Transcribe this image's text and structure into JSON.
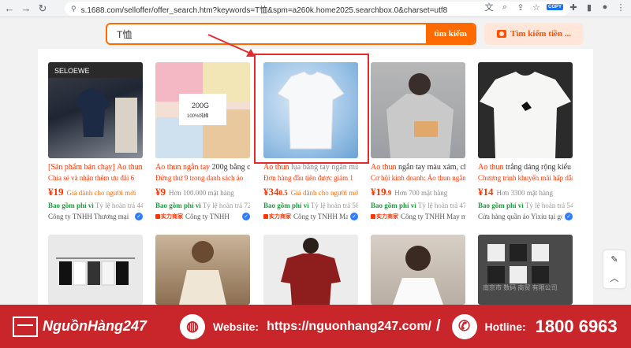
{
  "browser": {
    "url": "s.1688.com/selloffer/offer_search.htm?keywords=T恤&spm=a260k.home2025.searchbox.0&charset=utf8",
    "copy_badge": "COPY"
  },
  "search": {
    "value": "T恤",
    "button": "tìm kiếm",
    "image_search": "Tìm kiếm tiền ..."
  },
  "products": [
    {
      "title_hl": "[Sản phẩm bán chạy] Áo thun",
      "title_rest": "",
      "promo": "Chia sẻ và nhận thêm ưu đãi 6",
      "price_main": "¥19",
      "price_dec": "",
      "price_note": "Giá dành cho người mới",
      "ship_g": "Bao gồm phí vì",
      "ship_rest": "Tỷ lệ hoàn trả 44%",
      "badge": "",
      "shop": "Công ty TNHH Thương mại"
    },
    {
      "title_hl": "Áo thun ngắn tay",
      "title_rest": " 200g bằng c",
      "promo": "Đứng thứ 9 trong danh sách áo",
      "price_main": "¥9",
      "price_dec": "",
      "price_note": "Hơn 100.000 mặt hàng",
      "ship_g": "Bao gồm phí vì",
      "ship_rest": "Tỷ lệ hoàn trả 72%",
      "badge": "实力商家",
      "shop": "Công ty TNHH"
    },
    {
      "title_hl": "Áo thun",
      "title_rest": " lụa băng tay ngắn mù",
      "promo": "Đơn hàng đầu tiên được giảm 1",
      "price_main": "¥34",
      "price_dec": "0.5",
      "price_note": "Giá dành cho người mớ",
      "ship_g": "Bao gồm phí vì",
      "ship_rest": "Tỷ lệ hoàn trả 58%",
      "badge": "实力商家",
      "shop": "Công ty TNHH May"
    },
    {
      "title_hl": "Áo thun",
      "title_rest": " ngắn tay màu xám, ch",
      "promo": "Cơ hội kinh doanh: Áo thun ngắn",
      "price_main": "¥19",
      "price_dec": ".9",
      "price_note": "Hơn 700 mặt hàng",
      "ship_g": "Bao gồm phí vì",
      "ship_rest": "Tỷ lệ hoàn trả 47%",
      "badge": "实力商家",
      "shop": "Công ty TNHH May mặc Feien"
    },
    {
      "title_hl": "Áo thun",
      "title_rest": " trắng dáng rộng kiểu",
      "promo": "Chương trình khuyến mãi hấp dẫn:",
      "price_main": "¥14",
      "price_dec": "",
      "price_note": "Hơn 3300 mặt hàng",
      "ship_g": "Bao gồm phí vì",
      "ship_rest": "Tỷ lệ hoàn trả 54%",
      "badge": "",
      "shop": "Cửa hàng quần áo Yixiu tại góc"
    }
  ],
  "row2_texts": {
    "watermark": "南京市 数码 商贸 有限公司"
  },
  "footer": {
    "brand": "NguồnHàng247",
    "website_label": "Website:",
    "website": "https://nguonhang247.com/",
    "hotline_label": "Hotline:",
    "hotline": "1800 6963"
  }
}
